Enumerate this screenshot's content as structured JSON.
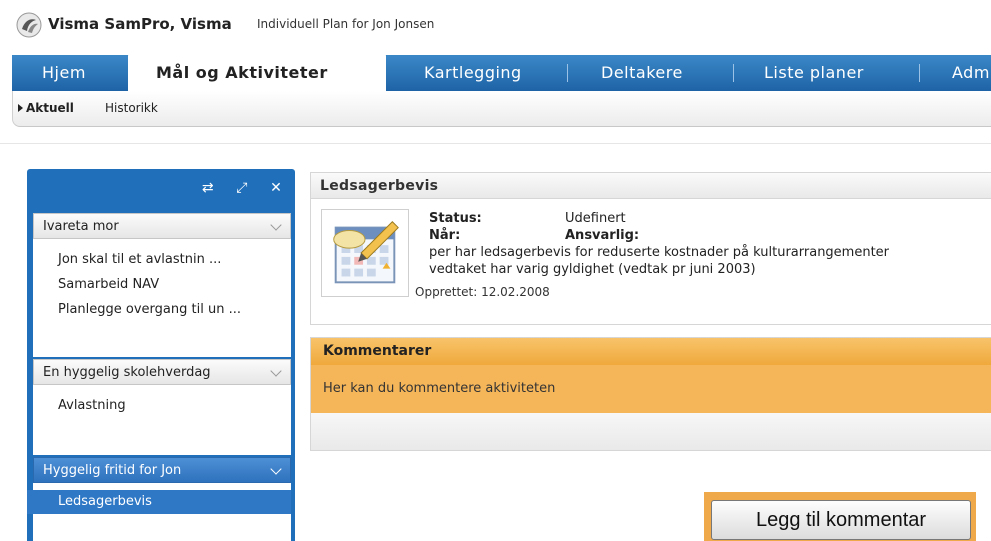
{
  "header": {
    "app_title": "Visma SamPro, Visma",
    "plan_title": "Individuell Plan for Jon Jonsen"
  },
  "tabs": [
    {
      "label": "Hjem"
    },
    {
      "label": "Mål og Aktiviteter"
    },
    {
      "label": "Kartlegging"
    },
    {
      "label": "Deltakere"
    },
    {
      "label": "Liste planer"
    },
    {
      "label": "Adm"
    }
  ],
  "subnav": {
    "current": "Aktuell",
    "history": "Historikk"
  },
  "sidebar": {
    "groups": [
      {
        "title": "Ivareta mor",
        "items": [
          "Jon skal til et avlastnin ...",
          "Samarbeid NAV",
          "Planlegge overgang til un ..."
        ]
      },
      {
        "title": "En hyggelig skolehverdag",
        "items": [
          "Avlastning"
        ]
      },
      {
        "title": "Hyggelig fritid for Jon",
        "items": [
          "Ledsagerbevis"
        ]
      }
    ]
  },
  "activity": {
    "title": "Ledsagerbevis",
    "status_label": "Status:",
    "status_value": "Udefinert",
    "when_label": "Når:",
    "responsible_label": "Ansvarlig:",
    "line1": "per har ledsagerbevis for reduserte kostnader på kulturarrangementer",
    "line2": "vedtaket har varig gyldighet (vedtak pr juni 2003)",
    "created": "Opprettet: 12.02.2008"
  },
  "comments": {
    "title": "Kommentarer",
    "hint": "Her kan du kommentere aktiviteten"
  },
  "actions": {
    "add_comment": "Legg til kommentar"
  }
}
